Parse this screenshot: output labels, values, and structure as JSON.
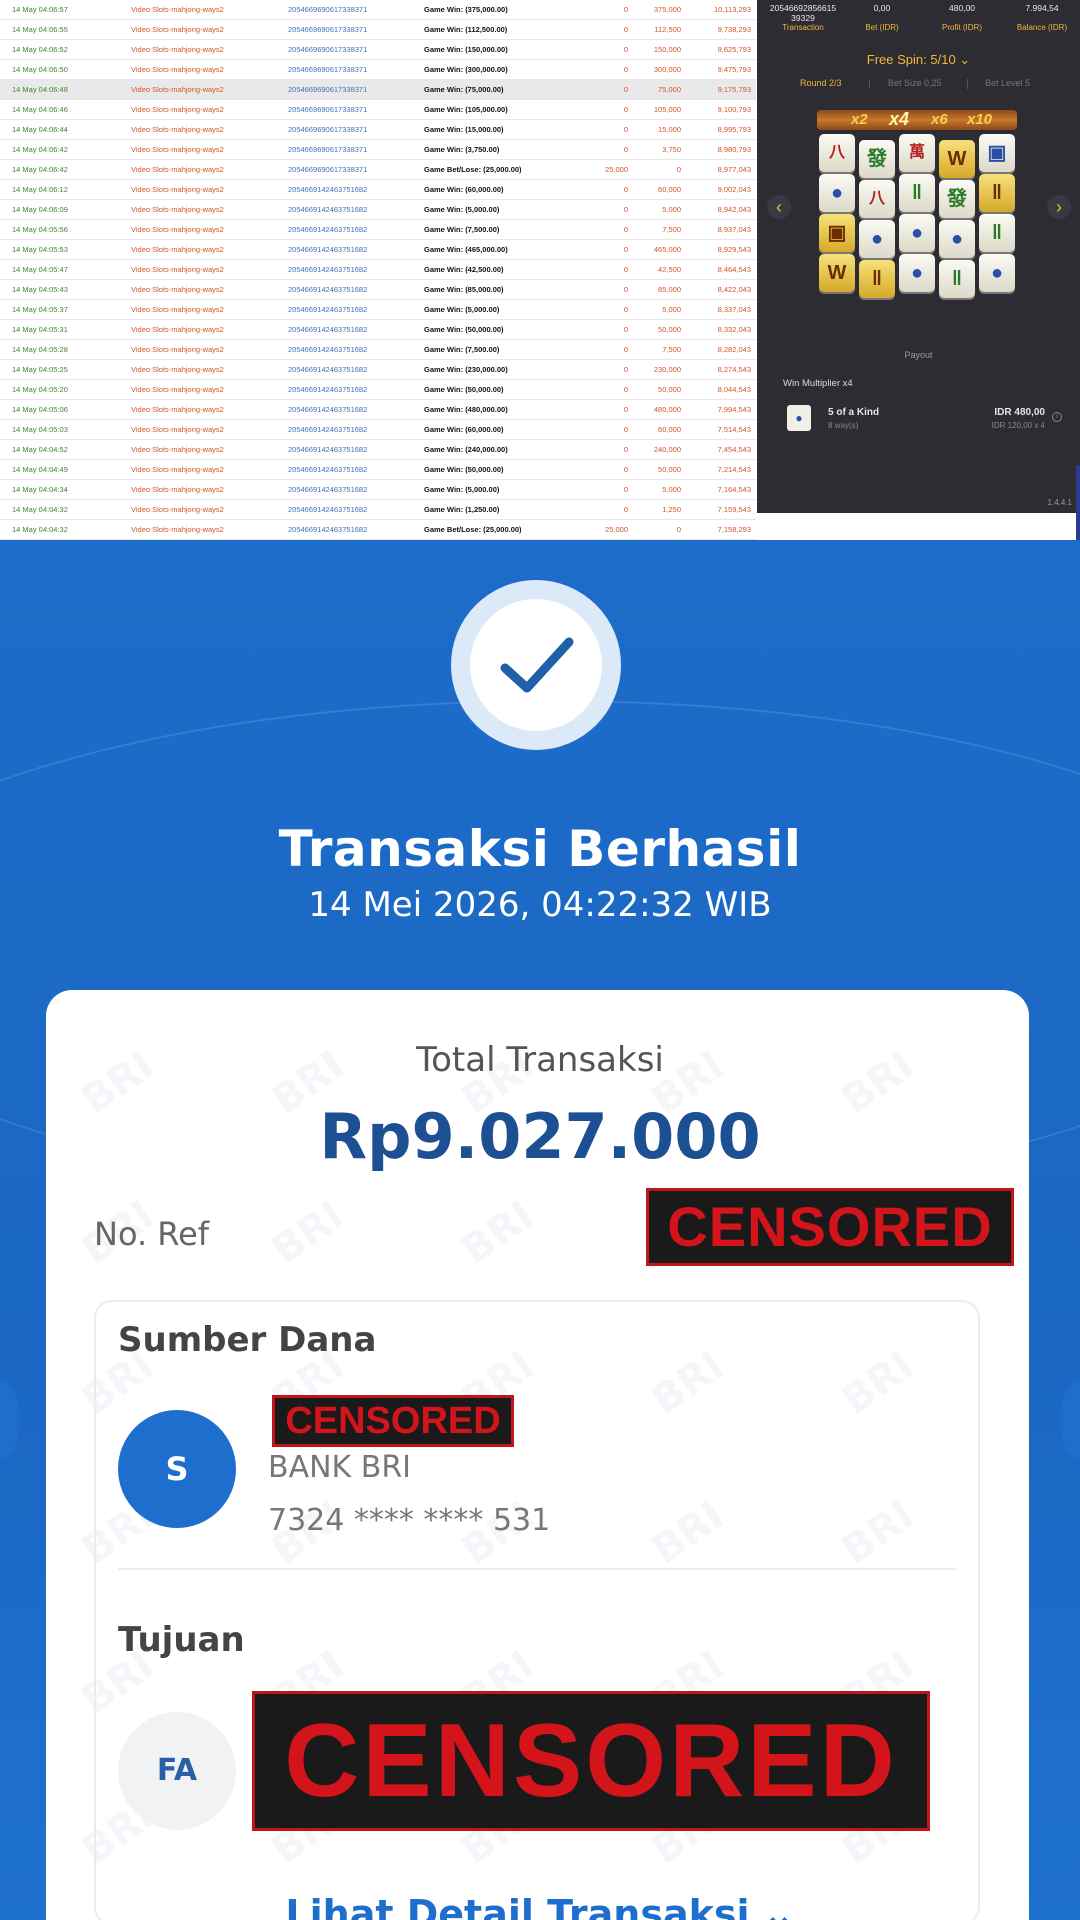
{
  "history": {
    "rows": [
      {
        "time": "14 May 04:06:57",
        "game": "Video Slots-mahjong-ways2",
        "tx": "2054669690617338371",
        "desc": "Game Win: (375,000.00)",
        "bet": "0",
        "win": "375,000",
        "balance": "10,113,293"
      },
      {
        "time": "14 May 04:06:55",
        "game": "Video Slots-mahjong-ways2",
        "tx": "2054669690617338371",
        "desc": "Game Win: (112,500.00)",
        "bet": "0",
        "win": "112,500",
        "balance": "9,738,293"
      },
      {
        "time": "14 May 04:06:52",
        "game": "Video Slots-mahjong-ways2",
        "tx": "2054669690617338371",
        "desc": "Game Win: (150,000.00)",
        "bet": "0",
        "win": "150,000",
        "balance": "9,625,793"
      },
      {
        "time": "14 May 04:06:50",
        "game": "Video Slots-mahjong-ways2",
        "tx": "2054669690617338371",
        "desc": "Game Win: (300,000.00)",
        "bet": "0",
        "win": "300,000",
        "balance": "9,475,793"
      },
      {
        "time": "14 May 04:06:48",
        "game": "Video Slots-mahjong-ways2",
        "tx": "2054669690617338371",
        "desc": "Game Win: (75,000.00)",
        "bet": "0",
        "win": "75,000",
        "balance": "9,175,793"
      },
      {
        "time": "14 May 04:06:46",
        "game": "Video Slots-mahjong-ways2",
        "tx": "2054669690617338371",
        "desc": "Game Win: (105,000.00)",
        "bet": "0",
        "win": "105,000",
        "balance": "9,100,793"
      },
      {
        "time": "14 May 04:06:44",
        "game": "Video Slots-mahjong-ways2",
        "tx": "2054669690617338371",
        "desc": "Game Win: (15,000.00)",
        "bet": "0",
        "win": "15,000",
        "balance": "8,995,793"
      },
      {
        "time": "14 May 04:06:42",
        "game": "Video Slots-mahjong-ways2",
        "tx": "2054669690617338371",
        "desc": "Game Win: (3,750.00)",
        "bet": "0",
        "win": "3,750",
        "balance": "8,980,793"
      },
      {
        "time": "14 May 04:06:42",
        "game": "Video Slots-mahjong-ways2",
        "tx": "2054669690617338371",
        "desc": "Game Bet/Lose: (25,000.00)",
        "bet": "25,000",
        "win": "0",
        "balance": "8,977,043"
      },
      {
        "time": "14 May 04:06:12",
        "game": "Video Slots-mahjong-ways2",
        "tx": "2054669142463751682",
        "desc": "Game Win: (60,000.00)",
        "bet": "0",
        "win": "60,000",
        "balance": "9,002,043"
      },
      {
        "time": "14 May 04:06:09",
        "game": "Video Slots-mahjong-ways2",
        "tx": "2054669142463751682",
        "desc": "Game Win: (5,000.00)",
        "bet": "0",
        "win": "5,000",
        "balance": "8,942,043"
      },
      {
        "time": "14 May 04:05:56",
        "game": "Video Slots-mahjong-ways2",
        "tx": "2054669142463751682",
        "desc": "Game Win: (7,500.00)",
        "bet": "0",
        "win": "7,500",
        "balance": "8,937,043"
      },
      {
        "time": "14 May 04:05:53",
        "game": "Video Slots-mahjong-ways2",
        "tx": "2054669142463751682",
        "desc": "Game Win: (465,000.00)",
        "bet": "0",
        "win": "465,000",
        "balance": "8,929,543"
      },
      {
        "time": "14 May 04:05:47",
        "game": "Video Slots-mahjong-ways2",
        "tx": "2054669142463751682",
        "desc": "Game Win: (42,500.00)",
        "bet": "0",
        "win": "42,500",
        "balance": "8,464,543"
      },
      {
        "time": "14 May 04:05:43",
        "game": "Video Slots-mahjong-ways2",
        "tx": "2054669142463751682",
        "desc": "Game Win: (85,000.00)",
        "bet": "0",
        "win": "85,000",
        "balance": "8,422,043"
      },
      {
        "time": "14 May 04:05:37",
        "game": "Video Slots-mahjong-ways2",
        "tx": "2054669142463751682",
        "desc": "Game Win: (5,000.00)",
        "bet": "0",
        "win": "5,000",
        "balance": "8,337,043"
      },
      {
        "time": "14 May 04:05:31",
        "game": "Video Slots-mahjong-ways2",
        "tx": "2054669142463751682",
        "desc": "Game Win: (50,000.00)",
        "bet": "0",
        "win": "50,000",
        "balance": "8,332,043"
      },
      {
        "time": "14 May 04:05:28",
        "game": "Video Slots-mahjong-ways2",
        "tx": "2054669142463751682",
        "desc": "Game Win: (7,500.00)",
        "bet": "0",
        "win": "7,500",
        "balance": "8,282,043"
      },
      {
        "time": "14 May 04:05:25",
        "game": "Video Slots-mahjong-ways2",
        "tx": "2054669142463751682",
        "desc": "Game Win: (230,000.00)",
        "bet": "0",
        "win": "230,000",
        "balance": "8,274,543"
      },
      {
        "time": "14 May 04:05:20",
        "game": "Video Slots-mahjong-ways2",
        "tx": "2054669142463751682",
        "desc": "Game Win: (50,000.00)",
        "bet": "0",
        "win": "50,000",
        "balance": "8,044,543"
      },
      {
        "time": "14 May 04:05:06",
        "game": "Video Slots-mahjong-ways2",
        "tx": "2054669142463751682",
        "desc": "Game Win: (480,000.00)",
        "bet": "0",
        "win": "480,000",
        "balance": "7,994,543"
      },
      {
        "time": "14 May 04:05:03",
        "game": "Video Slots-mahjong-ways2",
        "tx": "2054669142463751682",
        "desc": "Game Win: (60,000.00)",
        "bet": "0",
        "win": "60,000",
        "balance": "7,514,543"
      },
      {
        "time": "14 May 04:04:52",
        "game": "Video Slots-mahjong-ways2",
        "tx": "2054669142463751682",
        "desc": "Game Win: (240,000.00)",
        "bet": "0",
        "win": "240,000",
        "balance": "7,454,543"
      },
      {
        "time": "14 May 04:04:49",
        "game": "Video Slots-mahjong-ways2",
        "tx": "2054669142463751682",
        "desc": "Game Win: (50,000.00)",
        "bet": "0",
        "win": "50,000",
        "balance": "7,214,543"
      },
      {
        "time": "14 May 04:04:34",
        "game": "Video Slots-mahjong-ways2",
        "tx": "2054669142463751682",
        "desc": "Game Win: (5,000.00)",
        "bet": "0",
        "win": "5,000",
        "balance": "7,164,543"
      },
      {
        "time": "14 May 04:04:32",
        "game": "Video Slots-mahjong-ways2",
        "tx": "2054669142463751682",
        "desc": "Game Win: (1,250.00)",
        "bet": "0",
        "win": "1,250",
        "balance": "7,159,543"
      },
      {
        "time": "14 May 04:04:32",
        "game": "Video Slots-mahjong-ways2",
        "tx": "2054669142463751682",
        "desc": "Game Bet/Lose: (25,000.00)",
        "bet": "25,000",
        "win": "0",
        "balance": "7,158,293"
      }
    ]
  },
  "game_panel": {
    "transaction_id": "20546692856615 39329",
    "bet_value": "0,00",
    "profit_value": "480,00",
    "balance_value": "7.994,54",
    "labels": {
      "transaction": "Transaction",
      "bet": "Bet (IDR)",
      "profit": "Profit (IDR)",
      "balance": "Balance (IDR)"
    },
    "free_spin": "Free Spin: 5/10",
    "round": "Round 2/3",
    "bet_size": "Bet Size 0,25",
    "bet_level": "Bet Level 5",
    "multipliers": [
      "x2",
      "x4",
      "x6",
      "x10"
    ],
    "payout": "Payout",
    "win_multiplier": "Win Multiplier x4",
    "kind_name": "5 of a Kind",
    "kind_ways": "8 way(s)",
    "kind_amount": "IDR 480,00",
    "kind_calc": "IDR 120,00 x 4",
    "version": "1.4.4.1",
    "colors": {
      "accent": "#f0b83a",
      "panel": "#2d2c33"
    }
  },
  "receipt": {
    "title": "Transaksi Berhasil",
    "datetime": "14 Mei 2026, 04:22:32 WIB",
    "total_label": "Total Transaksi",
    "total_amount": "Rp9.027.000",
    "no_ref_label": "No. Ref",
    "censor_text": "CENSORED",
    "sumber_label": "Sumber Dana",
    "sumber_avatar": "S",
    "sumber_bank": "BANK BRI",
    "sumber_account": "7324 **** **** 531",
    "tujuan_label": "Tujuan",
    "tujuan_avatar": "FA",
    "detail_link": "Lihat Detail Transaksi",
    "watermark": "BRI",
    "colors": {
      "brand_blue": "#1e6fcd",
      "amount_blue": "#1d4f93",
      "censor_red": "#d3141b"
    }
  }
}
